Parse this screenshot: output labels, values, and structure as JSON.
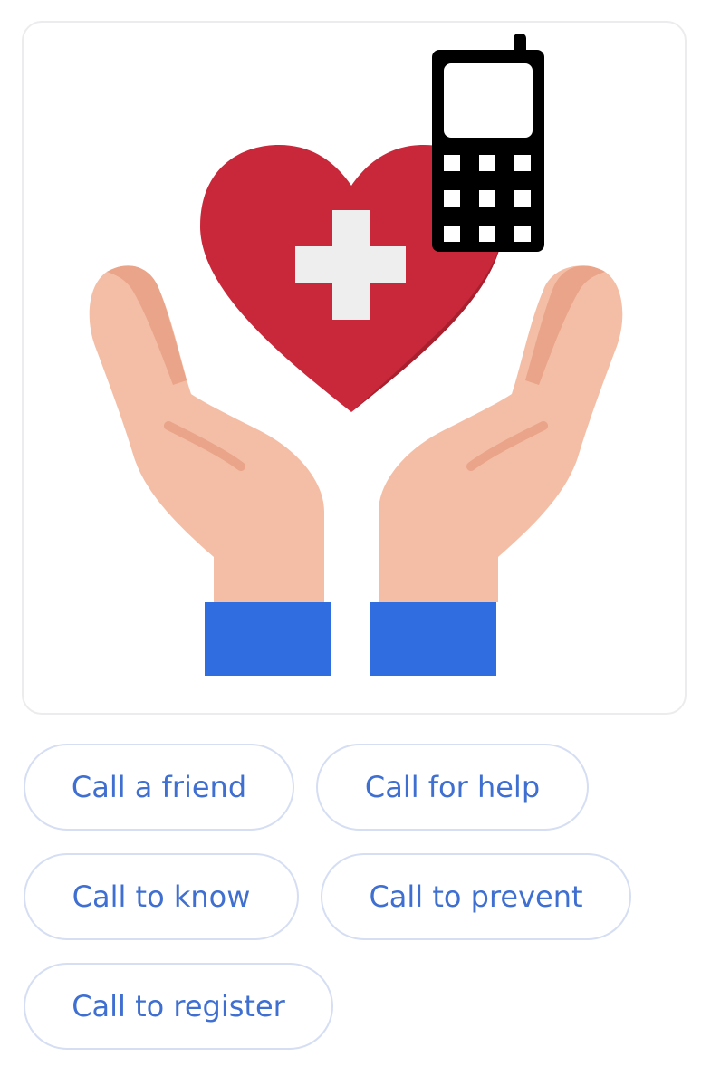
{
  "image": {
    "icon_names": [
      "hands-icon",
      "heart-icon",
      "medical-cross-icon",
      "mobile-phone-icon"
    ],
    "colors": {
      "heart": "#c8283a",
      "heart_shadow": "#a81f2e",
      "cross": "#eeeeee",
      "skin": "#f4bea6",
      "skin_dark": "#e9a489",
      "sleeve": "#2f6de1",
      "phone": "#000000"
    }
  },
  "suggestions": [
    {
      "label": "Call a friend"
    },
    {
      "label": "Call for help"
    },
    {
      "label": "Call to know"
    },
    {
      "label": "Call to prevent"
    },
    {
      "label": "Call to register"
    }
  ],
  "colors": {
    "chip_text": "#3f6fd1",
    "chip_border": "#d5def3",
    "card_border": "#ececee"
  }
}
